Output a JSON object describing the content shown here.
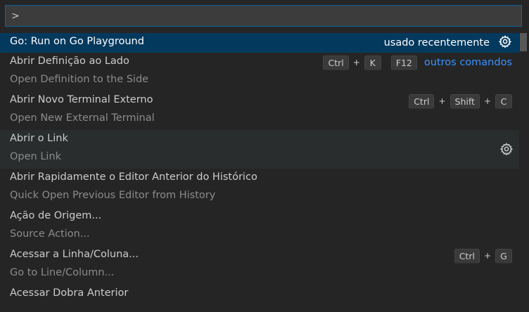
{
  "quick_open": {
    "input_value": ">"
  },
  "items": [
    {
      "label": "Go: Run on Go Playground",
      "detail": "",
      "recent": "usado recentemente",
      "has_gear": true,
      "keys": []
    },
    {
      "label": "Abrir Definição ao Lado",
      "detail": "Open Definition to the Side",
      "keys": [
        [
          "Ctrl",
          "K"
        ],
        [
          "F12"
        ]
      ],
      "others": "outros comandos"
    },
    {
      "label": "Abrir Novo Terminal Externo",
      "detail": "Open New External Terminal",
      "keys": [
        [
          "Ctrl",
          "Shift",
          "C"
        ]
      ]
    },
    {
      "label": "Abrir o Link",
      "detail": "Open Link",
      "has_gear": true,
      "keys": []
    },
    {
      "label": "Abrir Rapidamente o Editor Anterior do Histórico",
      "detail": "Quick Open Previous Editor from History",
      "keys": []
    },
    {
      "label": "Ação de Origem...",
      "detail": "Source Action...",
      "keys": []
    },
    {
      "label": "Acessar a Linha/Coluna...",
      "detail": "Go to Line/Column...",
      "keys": [
        [
          "Ctrl",
          "G"
        ]
      ]
    },
    {
      "label": "Acessar Dobra Anterior",
      "detail": "",
      "keys": []
    }
  ],
  "colors": {
    "background": "#252526",
    "selected": "#04395e",
    "hover": "#2a2d2e",
    "accent_link": "#3794ff"
  }
}
